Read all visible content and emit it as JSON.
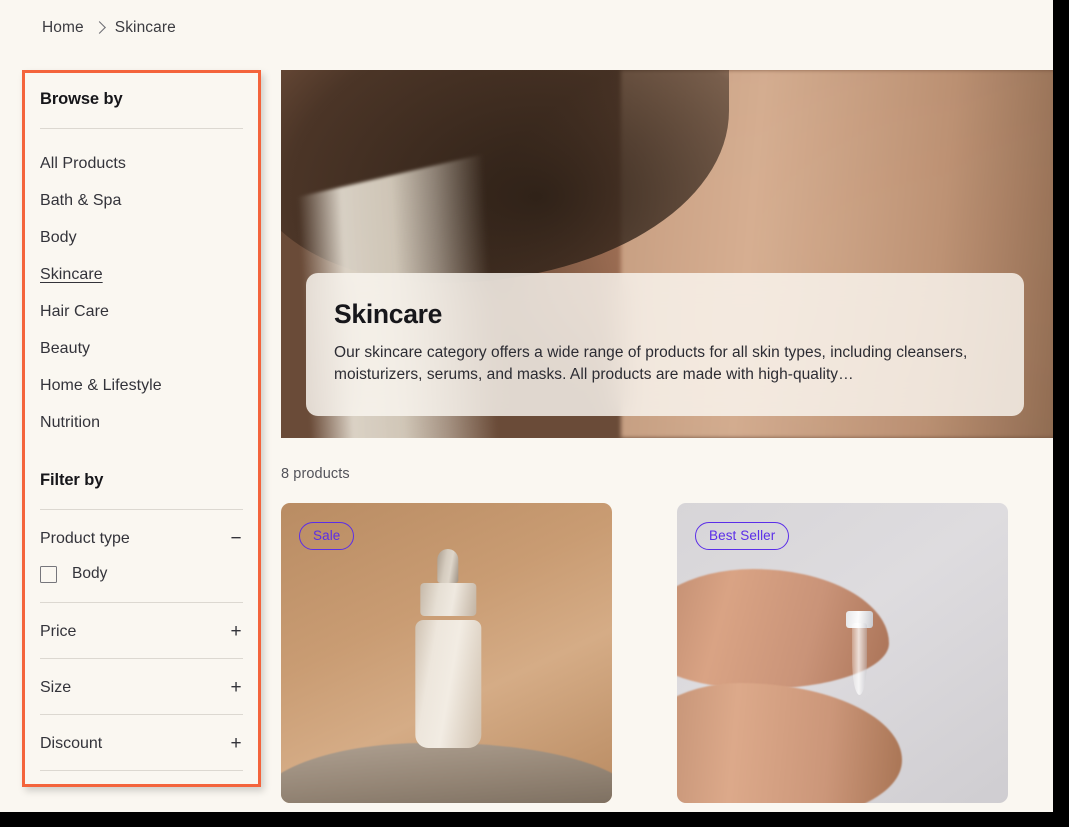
{
  "breadcrumb": {
    "items": [
      {
        "label": "Home"
      },
      {
        "label": "Skincare"
      }
    ],
    "separator_icon": "chevron-right-icon"
  },
  "sidebar": {
    "browse": {
      "title": "Browse by",
      "items": [
        {
          "label": "All Products",
          "active": false
        },
        {
          "label": "Bath & Spa",
          "active": false
        },
        {
          "label": "Body",
          "active": false
        },
        {
          "label": "Skincare",
          "active": true
        },
        {
          "label": "Hair Care",
          "active": false
        },
        {
          "label": "Beauty",
          "active": false
        },
        {
          "label": "Home & Lifestyle",
          "active": false
        },
        {
          "label": "Nutrition",
          "active": false
        }
      ]
    },
    "filter": {
      "title": "Filter by",
      "groups": [
        {
          "label": "Product type",
          "toggle": "−",
          "expanded": true,
          "options": [
            {
              "label": "Body",
              "checked": false
            }
          ]
        },
        {
          "label": "Price",
          "toggle": "+",
          "expanded": false,
          "options": []
        },
        {
          "label": "Size",
          "toggle": "+",
          "expanded": false,
          "options": []
        },
        {
          "label": "Discount",
          "toggle": "+",
          "expanded": false,
          "options": []
        }
      ]
    }
  },
  "hero": {
    "title": "Skincare",
    "description": "Our skincare category offers a wide range of products for all skin types, including cleansers, moisturizers, serums, and masks. All products are made with high-quality…",
    "image_alt": "woman-neck-shoulder-photo"
  },
  "main": {
    "product_count": "8 products",
    "products": [
      {
        "badge": "Sale",
        "image_alt": "serum-dropper-bottle-on-rock-photo"
      },
      {
        "badge": "Best Seller",
        "image_alt": "hands-applying-dropper-photo"
      }
    ]
  },
  "colors": {
    "page_background": "#FAF7F1",
    "annotation_border": "#F4643C",
    "badge_accent": "#5B2EE8",
    "text_primary": "#17171B",
    "text_secondary": "#53535A",
    "divider": "#DCD8D1"
  }
}
